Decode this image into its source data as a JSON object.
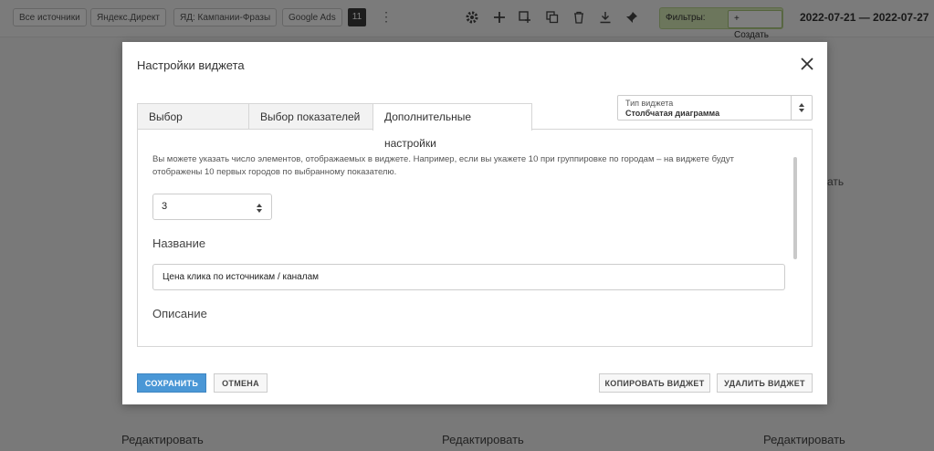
{
  "background": {
    "source_chips": [
      "Все источники",
      "Яндекс.Директ",
      "ЯД: Кампании-Фразы",
      "Google Ads"
    ],
    "count_badge": "11",
    "filters_label": "Фильтры:",
    "create_label": "+ Создать",
    "date_range": "2022-07-21 — 2022-07-27",
    "edit_label": "Редактировать",
    "side_fragment": "ать",
    "toolbar_icons": [
      "gear-icon",
      "plus-icon",
      "add-widget-icon",
      "copy-icon",
      "trash-icon",
      "download-icon",
      "pin-icon"
    ]
  },
  "modal": {
    "title": "Настройки виджета",
    "tabs": [
      {
        "label": "Выбор группировок",
        "active": false
      },
      {
        "label": "Выбор показателей",
        "active": false
      },
      {
        "label": "Дополнительные настройки",
        "active": true
      }
    ],
    "widget_type": {
      "label": "Тип виджета",
      "value": "Столбчатая диаграмма"
    },
    "hint": "Вы можете указать число элементов, отображаемых в виджете. Например, если вы укажете 10 при группировке по городам – на виджете будут отображены 10 первых городов по выбранному показателю.",
    "limit_value": "3",
    "name_section_title": "Название",
    "name_value": "Цена клика по источникам / каналам",
    "description_section_title": "Описание",
    "buttons": {
      "save": "СОХРАНИТЬ",
      "cancel": "ОТМЕНА",
      "copy": "КОПИРОВАТЬ ВИДЖЕТ",
      "delete": "УДАЛИТЬ ВИДЖЕТ"
    }
  },
  "colors": {
    "primary": "#4a97d6",
    "filters_bg": "#d9ecb8",
    "overlay": "rgba(0,0,0,0.5)"
  }
}
